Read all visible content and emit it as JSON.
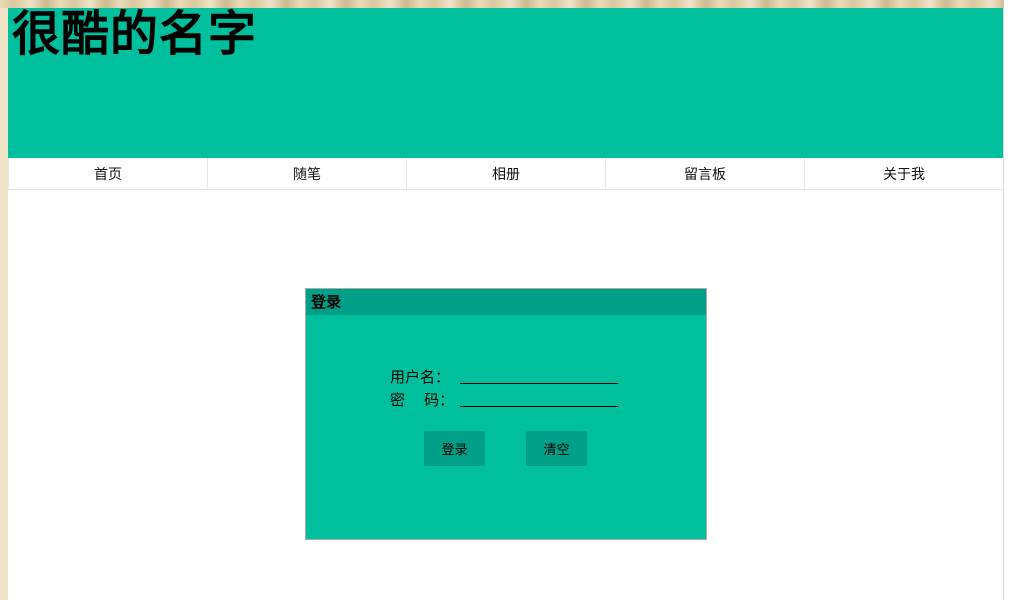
{
  "header": {
    "site_title": "很酷的名字"
  },
  "nav": {
    "items": [
      {
        "label": "首页"
      },
      {
        "label": "随笔"
      },
      {
        "label": "相册"
      },
      {
        "label": "留言板"
      },
      {
        "label": "关于我"
      }
    ]
  },
  "login": {
    "title": "登录",
    "username_label": "用户名：",
    "username_value": "",
    "password_label": "密    码：",
    "password_value": "",
    "login_button": "登录",
    "clear_button": "清空"
  },
  "colors": {
    "accent": "#00bf9d",
    "accent_dark": "#00a088"
  }
}
